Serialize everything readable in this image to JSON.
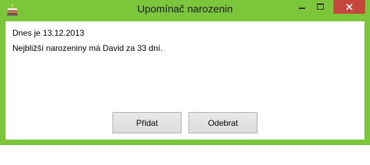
{
  "window": {
    "title": "Upomínač narozenin",
    "icons": {
      "app": "birthday-cake-icon",
      "minimize": "minimize-icon",
      "maximize": "maximize-icon",
      "close": "close-icon"
    },
    "accent_color": "#7cc63c",
    "close_color": "#c7463b"
  },
  "content": {
    "today_text": "Dnes je 13.12.2013",
    "nearest_birthday_text": "Nejbližší narozeniny má David za 33 dní."
  },
  "buttons": {
    "add_label": "Přidat",
    "remove_label": "Odebrat"
  }
}
